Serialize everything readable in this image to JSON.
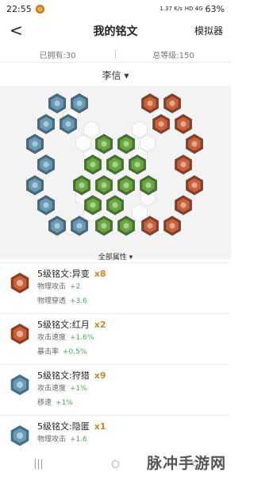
{
  "status": {
    "time": "22:55",
    "speed": "1.37 K/s",
    "net": "HD 4G",
    "battery": "63%"
  },
  "nav": {
    "back": "<",
    "title": "我的铭文",
    "simulator": "模拟器"
  },
  "stats": {
    "owned": "已拥有:30",
    "level": "总等级:150"
  },
  "hero": {
    "name": "李信",
    "chevron": "▾"
  },
  "attr_toggle": {
    "label": "全部属性",
    "chevron": "▾"
  },
  "colors": {
    "blue": "#6a9bb5",
    "green": "#68a83e",
    "red": "#c8623a",
    "gold": "#c9892a",
    "bonus": "#4caa55"
  },
  "runes": [
    {
      "title": "5级铭文:异变",
      "count": "x8",
      "color": "red",
      "attrs": [
        {
          "name": "物理攻击",
          "value": "+2"
        },
        {
          "name": "物理穿透",
          "value": "+3.6"
        }
      ]
    },
    {
      "title": "5级铭文:红月",
      "count": "x2",
      "color": "red",
      "attrs": [
        {
          "name": "攻击速度",
          "value": "+1.6%"
        },
        {
          "name": "暴击率",
          "value": "+0.5%"
        }
      ]
    },
    {
      "title": "5级铭文:狩猎",
      "count": "x9",
      "color": "blue",
      "attrs": [
        {
          "name": "攻击速度",
          "value": "+1%"
        },
        {
          "name": "移速",
          "value": "+1%"
        }
      ]
    },
    {
      "title": "5级铭文:隐匿",
      "count": "x1",
      "color": "blue",
      "attrs": [
        {
          "name": "物理攻击",
          "value": "+1.6"
        }
      ]
    }
  ],
  "bottom_nav": {
    "recent": "|||",
    "home": "○",
    "back": "<"
  },
  "watermark": "脉冲手游网"
}
